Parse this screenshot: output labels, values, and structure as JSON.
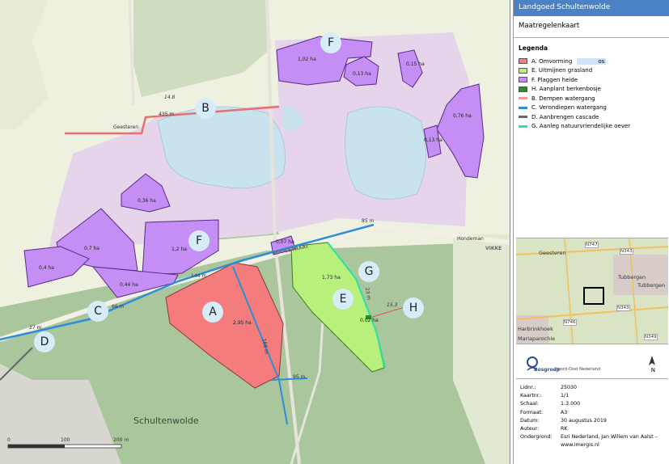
{
  "panel": {
    "title": "Landgoed Schultenwolde",
    "subtitle": "Maatregelenkaart",
    "legend_heading": "Legenda",
    "legend": [
      {
        "label": "A. Omvorming",
        "suffix": "os",
        "kind": "fill",
        "color": "#f47c7c"
      },
      {
        "label": "E. Uitmijnen grasland",
        "kind": "fill",
        "color": "#b7f07a"
      },
      {
        "label": "F. Plaggen heide",
        "kind": "fill",
        "color": "#c48ef5"
      },
      {
        "label": "H. Aanplant berkenbosje",
        "kind": "fill",
        "color": "#2e8b2e"
      },
      {
        "label": "B. Dempen watergang",
        "kind": "line",
        "color": "#f49a9a"
      },
      {
        "label": "C. Verondiepen watergang",
        "kind": "line",
        "color": "#2a8fd8"
      },
      {
        "label": "D. Aanbrengen cascade",
        "kind": "line",
        "color": "#666666"
      },
      {
        "label": "G. Aanleg natuurvriendelijke oever",
        "kind": "line",
        "color": "#28e0a8"
      }
    ],
    "inset_labels": {
      "geesteren": "Geesteren",
      "tubbergen": "Tubbergen",
      "harbrinkhoek": "Harbrinkhoek",
      "mariaparochie": "Mariaparochie",
      "n343": "N343",
      "n747": "N747",
      "n746": "N746",
      "n349": "N349",
      "tubbergen_short": "Tubbergen"
    },
    "logo": {
      "name": "Bosgroep",
      "sub": "Noord-Oost Nederland",
      "north": "N"
    },
    "meta": [
      {
        "key": "Lidnr.:",
        "value": "25030"
      },
      {
        "key": "Kaartnr.:",
        "value": "1/1"
      },
      {
        "key": "Schaal:",
        "value": "1:3.000"
      },
      {
        "key": "Formaat:",
        "value": "A3"
      },
      {
        "key": "Datum:",
        "value": "30 augustus 2019"
      },
      {
        "key": "Auteur:",
        "value": "RK"
      },
      {
        "key": "Ondergrond:",
        "value": "Esri Nederland, Jan Willem van Aalst –"
      },
      {
        "key": "",
        "value": "www.imergis.nl"
      }
    ]
  },
  "map": {
    "circles": [
      "A",
      "B",
      "C",
      "D",
      "E",
      "F",
      "F",
      "G",
      "H"
    ],
    "areas": {
      "f_1_02": "1,02 ha",
      "f_0_13a": "0,13 ha",
      "f_0_15": "0,15 ha",
      "f_0_76": "0,76 ha",
      "f_0_13b": "0,13 ha",
      "f_0_36": "0,36 ha",
      "f_0_7": "0,7 ha",
      "f_1_2": "1,2 ha",
      "f_0_4": "0,4 ha",
      "f_0_44": "0,44 ha",
      "f_0_07": "0,07 ha",
      "a_2_95": "2,95 ha",
      "e_1_73": "1,73 ha",
      "h_0_02": "0,02 ha"
    },
    "lengths": {
      "b_435": "435 m",
      "c_144": "144 m",
      "c_85": "85 m",
      "c_66": "66 m",
      "c_27": "27 m",
      "c_95": "95 m",
      "c_186": "186 m",
      "g_23": "23 m"
    },
    "names": {
      "geesteren": "Geesteren",
      "hondeman": "Hondeman",
      "vikke": "VIKKE",
      "schultenwolde": "Schultenwolde",
      "hoogstraat": "HOOGSTRAAT",
      "n14_8": "14.8",
      "n15_3": "15.3"
    },
    "scale": {
      "s0": "0",
      "s100": "100",
      "s200": "200 m"
    }
  }
}
